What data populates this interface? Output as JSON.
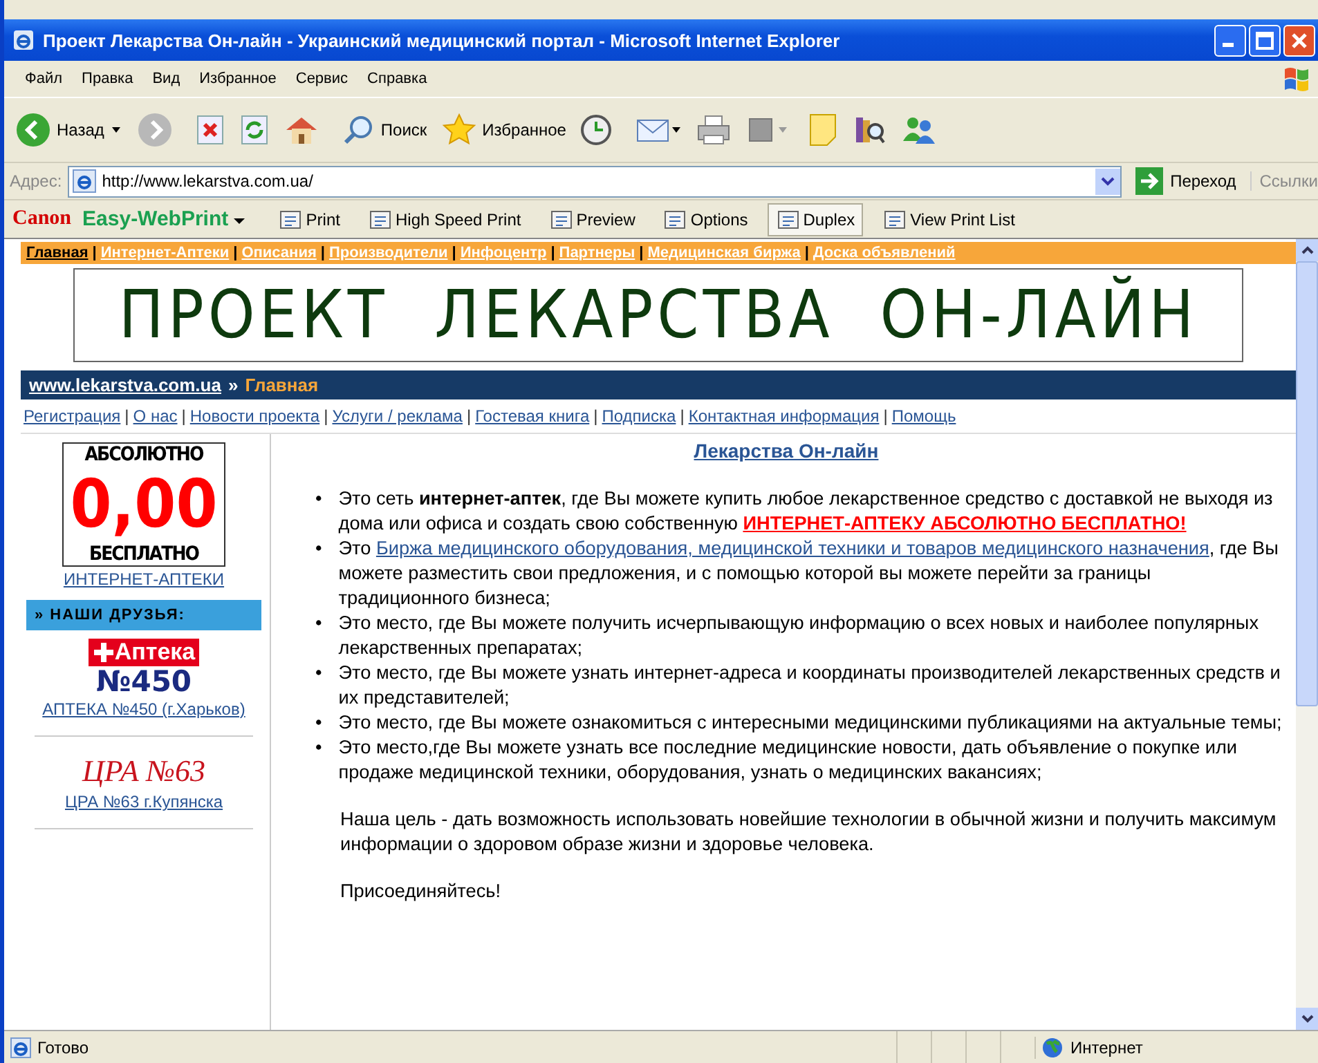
{
  "window": {
    "title": "Проект Лекарства Он-лайн  -  Украинский медицинский портал - Microsoft Internet Explorer"
  },
  "menu": [
    "Файл",
    "Правка",
    "Вид",
    "Избранное",
    "Сервис",
    "Справка"
  ],
  "toolbar": [
    {
      "kind": "back",
      "label": "Назад"
    },
    {
      "kind": "forward"
    },
    {
      "kind": "stop"
    },
    {
      "kind": "refresh"
    },
    {
      "kind": "home"
    },
    {
      "kind": "search",
      "label": "Поиск"
    },
    {
      "kind": "favorites",
      "label": "Избранное"
    },
    {
      "kind": "history"
    },
    {
      "kind": "mail"
    },
    {
      "kind": "print"
    },
    {
      "kind": "edit"
    },
    {
      "kind": "note"
    },
    {
      "kind": "research"
    },
    {
      "kind": "messenger"
    }
  ],
  "address": {
    "label": "Адрес:",
    "value": "http://www.lekarstva.com.ua/",
    "go": "Переход",
    "links": "Ссылки"
  },
  "print_bar": {
    "brand": "Canon",
    "product": "Easy-WebPrint",
    "buttons": [
      {
        "label": "Print",
        "on": false
      },
      {
        "label": "High Speed Print",
        "on": false
      },
      {
        "label": "Preview",
        "on": false
      },
      {
        "label": "Options",
        "on": false
      },
      {
        "label": "Duplex",
        "on": true
      },
      {
        "label": "View Print List",
        "on": false
      }
    ]
  },
  "page": {
    "top_nav": [
      {
        "label": "Главная",
        "selected": true
      },
      {
        "label": "Интернет-Аптеки",
        "selected": false
      },
      {
        "label": "Описания",
        "selected": false
      },
      {
        "label": "Производители",
        "selected": false
      },
      {
        "label": "Инфоцентр",
        "selected": false
      },
      {
        "label": "Партнеры",
        "selected": false
      },
      {
        "label": "Медицинская биржа",
        "selected": false
      },
      {
        "label": "Доска объявлений",
        "selected": false
      }
    ],
    "top_nav_separator": "|",
    "banner": "ПРОЕКТ  ЛЕКАРСТВА  ОН-ЛАЙН",
    "breadcrumb": {
      "site": "www.lekarstva.com.ua",
      "separator": "»",
      "current": "Главная"
    },
    "sub_nav_separator": "|",
    "sub_nav": [
      "Регистрация",
      "О нас",
      "Новости проекта",
      "Услуги / реклама",
      "Гостевая книга",
      "Подписка",
      "Контактная информация",
      "Помощь"
    ],
    "sidebar": {
      "promo": {
        "top": "АБСОЛЮТНО",
        "amount": "0,00",
        "bottom": "БЕСПЛАТНО"
      },
      "promo_link": "ИНТЕРНЕТ-АПТЕКИ",
      "friends_heading": "» НАШИ ДРУЗЬЯ:",
      "friends": [
        {
          "kind": "cross",
          "logo": [
            "Аптека",
            "№450"
          ],
          "link": "АПТЕКА №450 (г.Харьков)"
        },
        {
          "kind": "script",
          "logo": [
            "ЦРА №63"
          ],
          "link": "ЦРА №63 г.Купянска"
        }
      ]
    },
    "main": {
      "heading": "Лекарства Он-лайн",
      "bullet": "•",
      "bullets": [
        [
          {
            "kind": "plain",
            "text": "Это сеть "
          },
          {
            "kind": "bold",
            "text": "интернет-аптек"
          },
          {
            "kind": "plain",
            "text": ", где Вы можете купить любое лекарственное средство с доставкой не выходя из дома или офиса и создать свою собственную "
          },
          {
            "kind": "alert",
            "text": "ИНТЕРНЕТ-АПТЕКУ АБСОЛЮТНО БЕСПЛАТНО!"
          }
        ],
        [
          {
            "kind": "plain",
            "text": "Это "
          },
          {
            "kind": "link",
            "text": "Биржа медицинского оборудования, медицинской техники и товаров медицинского назначения"
          },
          {
            "kind": "plain",
            "text": ", где Вы можете разместить свои предложения, и с помощью которой вы можете перейти за границы традиционного бизнеса;"
          }
        ],
        [
          {
            "kind": "plain",
            "text": "Это место, где Вы можете получить исчерпывающую информацию о всех новых и наиболее популярных лекарственных препаратах;"
          }
        ],
        [
          {
            "kind": "plain",
            "text": "Это место, где Вы можете узнать интернет-адреса и координаты производителей лекарственных средств и их представителей;"
          }
        ],
        [
          {
            "kind": "plain",
            "text": "Это место, где Вы можете ознакомиться с интересными медицинскими публикациями на актуальные темы;"
          }
        ],
        [
          {
            "kind": "plain",
            "text": "Это место,где Вы можете узнать все последние медицинские новости, дать объявление о покупке или продаже медицинской техники, оборудования, узнать о медицинских вакансиях;"
          }
        ]
      ],
      "paragraphs": [
        "Наша цель - дать возможность использовать новейшие технологии в обычной жизни и получить максимум информации о здоровом образе жизни и здоровье человека.",
        "Присоединяйтесь!"
      ]
    }
  },
  "status_bar": {
    "text": "Готово",
    "zone": "Интернет"
  }
}
